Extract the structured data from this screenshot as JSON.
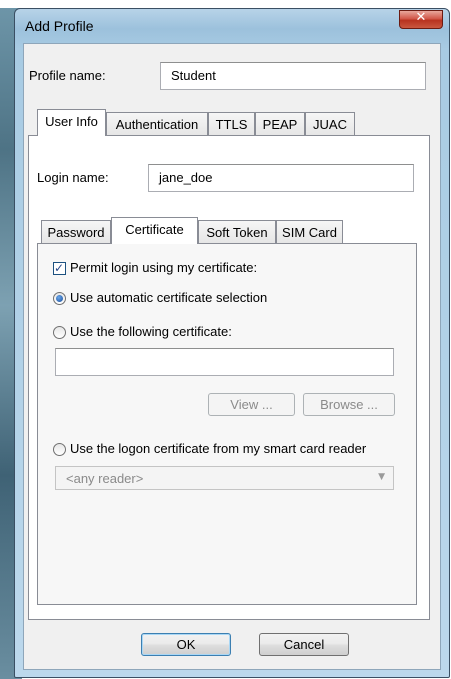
{
  "window": {
    "title": "Add Profile",
    "close_glyph": "✕"
  },
  "profile": {
    "label": "Profile name:",
    "value": "Student"
  },
  "outer_tabs": [
    "User Info",
    "Authentication",
    "TTLS",
    "PEAP",
    "JUAC"
  ],
  "login": {
    "label": "Login name:",
    "value": "jane_doe"
  },
  "inner_tabs": [
    "Password",
    "Certificate",
    "Soft Token",
    "SIM Card"
  ],
  "certificate": {
    "permit_label": "Permit login using my certificate:",
    "permit_checked": true,
    "auto_label": "Use automatic certificate selection",
    "following_label": "Use the following certificate:",
    "following_value": "",
    "view_label": "View ...",
    "browse_label": "Browse ...",
    "smartcard_label": "Use the logon certificate from my smart card reader",
    "reader_value": "<any reader>",
    "selected_option": "auto"
  },
  "buttons": {
    "ok": "OK",
    "cancel": "Cancel"
  },
  "colors": {
    "title_bg": "#a8cbe3",
    "close_red": "#c9402c",
    "radio_blue": "#1b4e9b"
  }
}
